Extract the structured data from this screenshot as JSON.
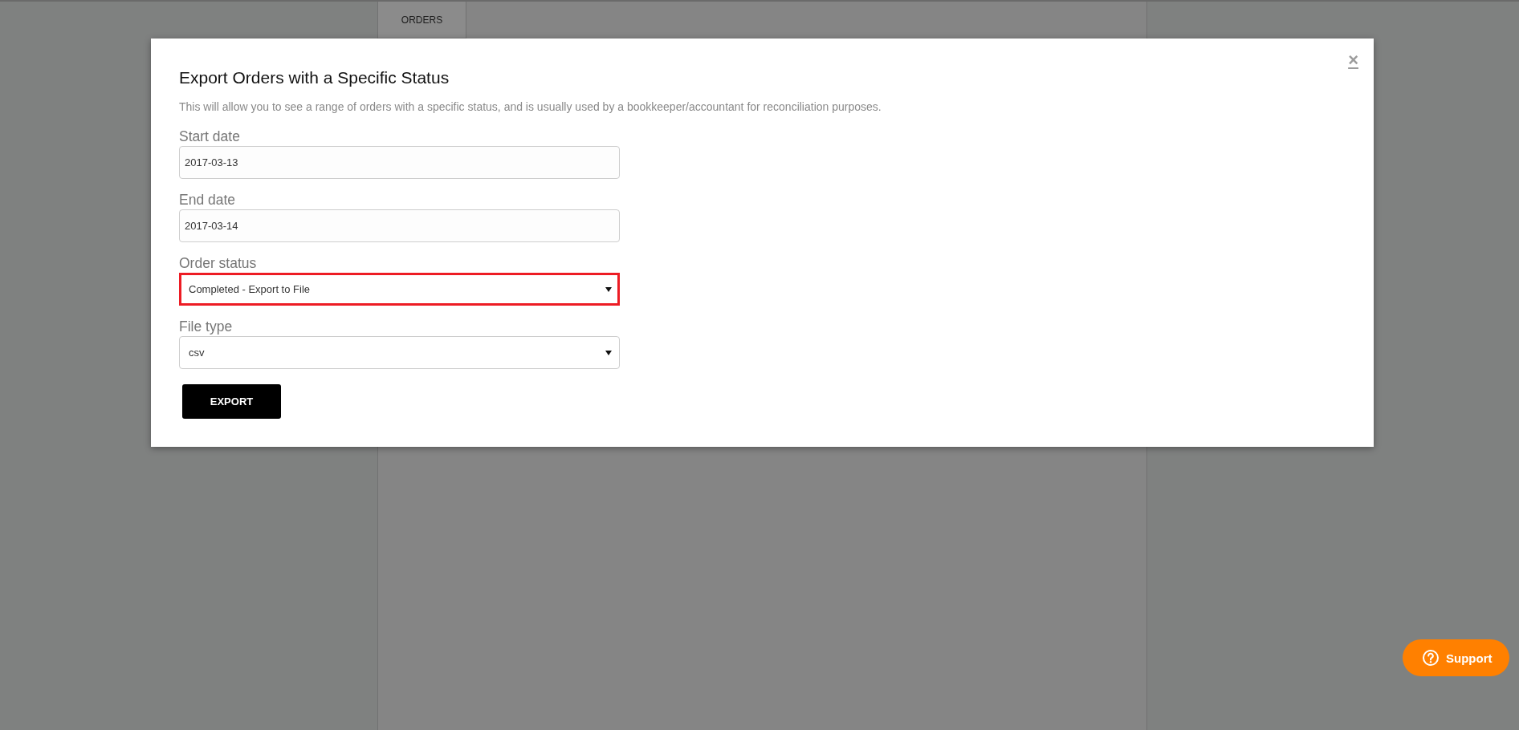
{
  "background": {
    "tabs": [
      {
        "label": "ORDERS",
        "selected": true
      }
    ]
  },
  "dialog": {
    "title": "Export Orders with a Specific Status",
    "description": "This will allow you to see a range of orders with a specific status, and is usually used by a bookkeeper/accountant for reconciliation purposes.",
    "close": "×",
    "fields": [
      {
        "kind": "text",
        "label": "Start date",
        "value": "2017-03-13",
        "highlighted": false
      },
      {
        "kind": "text",
        "label": "End date",
        "value": "2017-03-14",
        "highlighted": false
      },
      {
        "kind": "select",
        "label": "Order status",
        "value": "Completed - Export to File",
        "highlighted": true
      },
      {
        "kind": "select",
        "label": "File type",
        "value": "csv",
        "highlighted": false
      }
    ],
    "submit": "EXPORT"
  },
  "support": {
    "label": "Support"
  }
}
